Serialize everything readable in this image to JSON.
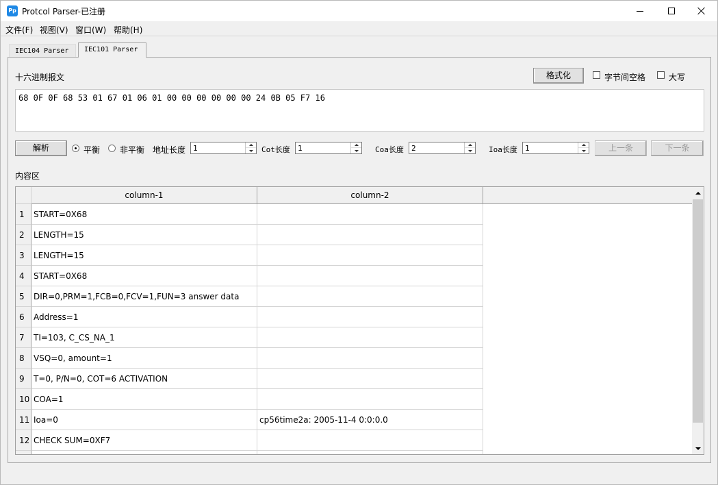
{
  "window": {
    "title": "Protcol Parser-已注册",
    "icon_text": "Pp",
    "icon_name": "app-icon"
  },
  "menu": [
    "文件(F)",
    "视图(V)",
    "窗口(W)",
    "帮助(H)"
  ],
  "tabs": [
    "IEC104 Parser",
    "IEC101 Parser"
  ],
  "active_tab": "IEC101 Parser",
  "hex_section": {
    "label": "十六进制报文",
    "format_button": "格式化",
    "byte_space_label": "字节间空格",
    "uppercase_label": "大写",
    "byte_space_checked": false,
    "uppercase_checked": false,
    "hex_value": "68 0F 0F 68 53 01 67 01 06 01 00 00 00 00 00 00 24 0B 05 F7 16"
  },
  "controls": {
    "parse_button": "解析",
    "balanced_label": "平衡",
    "unbalanced_label": "非平衡",
    "balanced_selected": true,
    "addr_len_label": "地址长度",
    "addr_len_value": "1",
    "cot_len_label": "Cot长度",
    "cot_len_value": "1",
    "coa_len_label": "Coa长度",
    "coa_len_value": "2",
    "ioa_len_label": "Ioa长度",
    "ioa_len_value": "1",
    "prev_button": "上一条",
    "next_button": "下一条"
  },
  "content": {
    "label": "内容区",
    "columns": [
      "column-1",
      "column-2"
    ],
    "rows": [
      {
        "num": "1",
        "c1": "START=0X68",
        "c2": ""
      },
      {
        "num": "2",
        "c1": "LENGTH=15",
        "c2": ""
      },
      {
        "num": "3",
        "c1": "LENGTH=15",
        "c2": ""
      },
      {
        "num": "4",
        "c1": "START=0X68",
        "c2": ""
      },
      {
        "num": "5",
        "c1": "DIR=0,PRM=1,FCB=0,FCV=1,FUN=3 answer data",
        "c2": ""
      },
      {
        "num": "6",
        "c1": "Address=1",
        "c2": ""
      },
      {
        "num": "7",
        "c1": "TI=103, C_CS_NA_1",
        "c2": ""
      },
      {
        "num": "8",
        "c1": "VSQ=0, amount=1",
        "c2": ""
      },
      {
        "num": "9",
        "c1": "T=0, P/N=0, COT=6 ACTIVATION",
        "c2": ""
      },
      {
        "num": "10",
        "c1": "COA=1",
        "c2": ""
      },
      {
        "num": "11",
        "c1": "Ioa=0",
        "c2": "cp56time2a: 2005-11-4 0:0:0.0"
      },
      {
        "num": "12",
        "c1": "CHECK SUM=0XF7",
        "c2": ""
      }
    ]
  }
}
